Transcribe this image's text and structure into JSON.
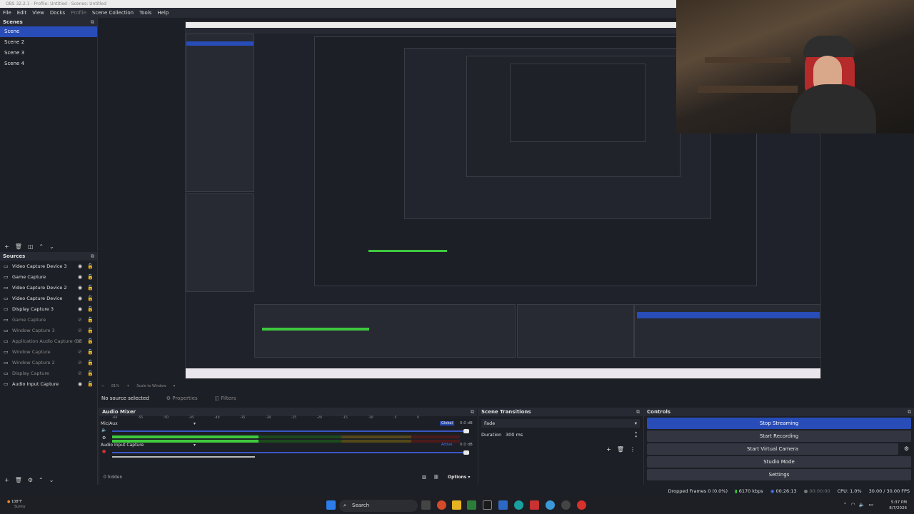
{
  "window": {
    "title": "OBS 32.2.1 - Profile: Untitled - Scenes: Untitled"
  },
  "menu": [
    "File",
    "Edit",
    "View",
    "Docks",
    "Profile",
    "Scene Collection",
    "Tools",
    "Help"
  ],
  "scenes": {
    "title": "Scenes",
    "items": [
      "Scene",
      "Scene 2",
      "Scene 3",
      "Scene 4"
    ]
  },
  "sources": {
    "title": "Sources",
    "items": [
      {
        "name": "Video Capture Device 3",
        "visible": true
      },
      {
        "name": "Game Capture",
        "visible": true
      },
      {
        "name": "Video Capture Device 2",
        "visible": true
      },
      {
        "name": "Video Capture Device",
        "visible": true
      },
      {
        "name": "Display Capture 3",
        "visible": true
      },
      {
        "name": "Game Capture",
        "visible": false
      },
      {
        "name": "Window Capture 3",
        "visible": false
      },
      {
        "name": "Application Audio Capture (BE",
        "visible": false
      },
      {
        "name": "Window Capture",
        "visible": false
      },
      {
        "name": "Window Capture 2",
        "visible": false
      },
      {
        "name": "Display Capture",
        "visible": false
      },
      {
        "name": "Audio Input Capture",
        "visible": true
      }
    ]
  },
  "scale": {
    "zoom": "81%",
    "mode": "Scale to Window"
  },
  "source_bar": {
    "selection": "No source selected",
    "properties": "Properties",
    "filters": "Filters"
  },
  "mixer": {
    "title": "Audio Mixer",
    "ticks": [
      "-60",
      "-55",
      "-50",
      "-45",
      "-40",
      "-35",
      "-30",
      "-25",
      "-20",
      "-15",
      "-10",
      "-5",
      "0"
    ],
    "channels": [
      {
        "name": "Mic/Aux",
        "badge": "Global",
        "db": "0.0 dB",
        "level": 0.42
      },
      {
        "name": "Audio Input Capture",
        "badge": "Active",
        "db": "0.0 dB",
        "level": 0.0
      }
    ],
    "hidden": "0 hidden",
    "options": "Options"
  },
  "transitions": {
    "title": "Scene Transitions",
    "selected": "Fade",
    "duration_label": "Duration",
    "duration": "300 ms"
  },
  "controls": {
    "title": "Controls",
    "buttons": [
      "Stop Streaming",
      "Start Recording",
      "Start Virtual Camera",
      "Studio Mode",
      "Settings"
    ]
  },
  "status": {
    "dropped": "Dropped Frames 0 (0.0%)",
    "bitrate": "6170 kbps",
    "stream_time": "00:26:13",
    "rec_time": "00:00:00",
    "cpu": "CPU: 1.0%",
    "fps": "30.00 / 30.00 FPS"
  },
  "taskbar": {
    "weather_temp": "108°F",
    "weather_desc": "Sunny",
    "search": "Search",
    "time": "5:37 PM",
    "date": "8/7/2026"
  },
  "colors": {
    "accent": "#284cb8",
    "meter_green": "#3ec93e",
    "background": "#1d1f26",
    "panel": "#272a33"
  }
}
